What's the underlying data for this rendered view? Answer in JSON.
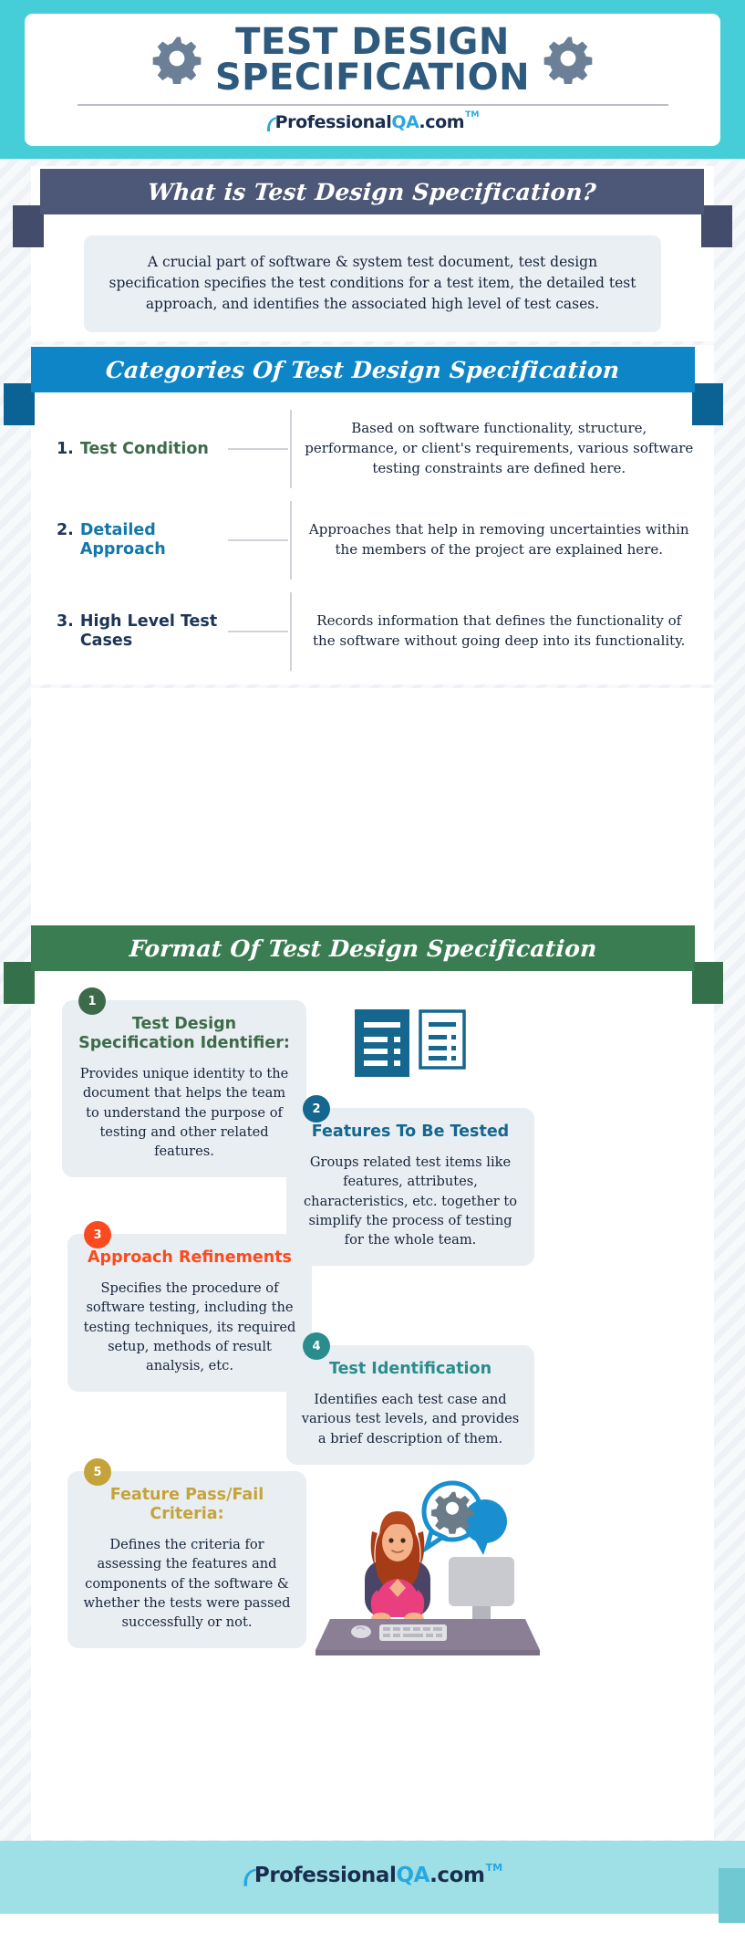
{
  "brand": {
    "logo_part1": "P",
    "logo_part2": "rofessional",
    "logo_part3": "QA",
    "logo_part4": ".com",
    "tm": "TM",
    "accent_teal": "#45cdd8",
    "accent_blue": "#0d85c6",
    "accent_green": "#3a7d52",
    "accent_slate": "#4d5878"
  },
  "hero": {
    "title_line1": "TEST DESIGN",
    "title_line2": "SPECIFICATION",
    "left_icon": "gear-icon",
    "right_icon": "gear-icon"
  },
  "whatis": {
    "heading": "What is Test Design Specification?",
    "body": "A crucial part of software & system test document, test design specification specifies the test conditions for a test item, the detailed test approach, and identifies the associated high level of test cases."
  },
  "categories": {
    "heading": "Categories Of Test Design Specification",
    "items": [
      {
        "number": "1.",
        "name": "Test Condition",
        "color": "#3d6b4a",
        "description": "Based on software functionality, structure, performance, or client's requirements, various software testing constraints are defined here."
      },
      {
        "number": "2.",
        "name": "Detailed Approach",
        "color": "#1278ab",
        "description": "Approaches that help in removing uncertainties within the members of the project are explained here."
      },
      {
        "number": "3.",
        "name": "High Level Test Cases",
        "color": "#1d3557",
        "description": "Records information that defines the functionality of the software without going deep into its functionality."
      }
    ]
  },
  "format": {
    "heading": "Format Of Test Design Specification",
    "cards": [
      {
        "badge": "1",
        "title": "Test Design Specification Identifier:",
        "color": "#3d6b4a",
        "text": "Provides unique identity to the document that helps the team to understand the purpose of testing and other related features."
      },
      {
        "badge": "2",
        "title": "Features To Be Tested",
        "color": "#15678f",
        "text": "Groups related test items like features, attributes, characteristics, etc. together to simplify the process of testing for the whole team."
      },
      {
        "badge": "3",
        "title": "Approach Refinements",
        "color": "#fc4a1f",
        "text": "Specifies the procedure of software testing, including the testing techniques, its required setup, methods of result analysis, etc."
      },
      {
        "badge": "4",
        "title": "Test Identification",
        "color": "#2a8c8c",
        "text": "Identifies each test case and various test levels, and provides a brief description of them."
      },
      {
        "badge": "5",
        "title": "Feature Pass/Fail Criteria:",
        "color": "#c4a43a",
        "text": "Defines the criteria for assessing the features and components of the software & whether the tests were passed successfully or not."
      }
    ],
    "doc_icon_left": "document-filled-icon",
    "doc_icon_right": "document-outline-icon",
    "illustration": "woman-at-desk-with-gear-thought-bubble-illustration"
  }
}
